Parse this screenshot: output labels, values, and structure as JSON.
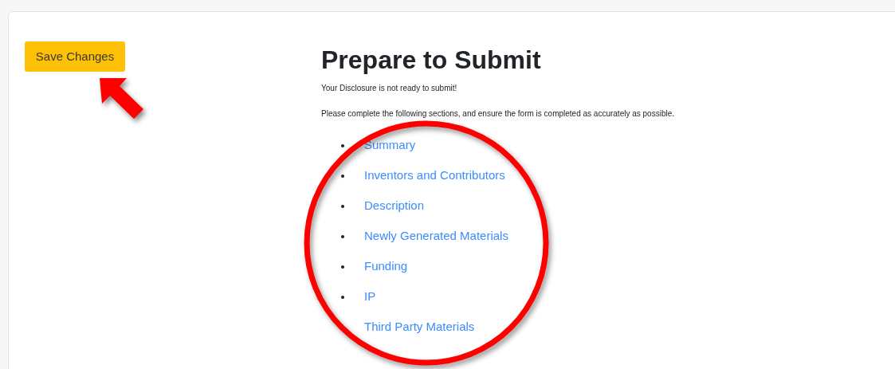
{
  "save_button": {
    "label": "Save Changes"
  },
  "heading": "Prepare to Submit",
  "status_message": "Your Disclosure is not ready to submit!",
  "instructions": "Please complete the following sections, and ensure the form is completed as accurately as possible.",
  "sections": [
    {
      "label": "Summary"
    },
    {
      "label": "Inventors and Contributors"
    },
    {
      "label": "Description"
    },
    {
      "label": "Newly Generated Materials"
    },
    {
      "label": "Funding"
    },
    {
      "label": "IP"
    },
    {
      "label": "Third Party Materials"
    }
  ]
}
